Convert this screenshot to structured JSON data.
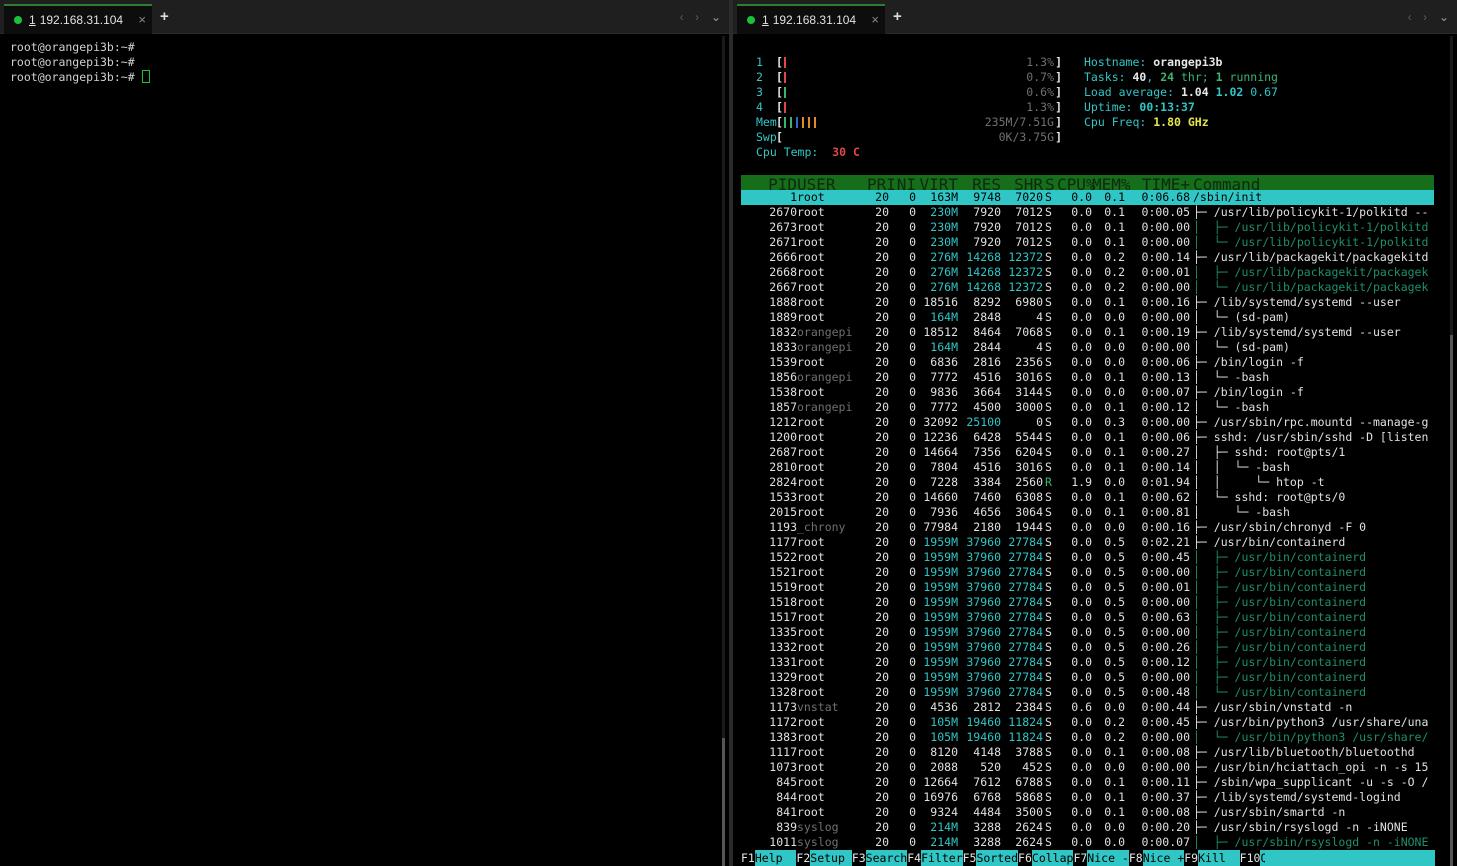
{
  "left_pane": {
    "tab": {
      "number": "1",
      "title": "192.168.31.104",
      "close": "×"
    },
    "new_tab": "+",
    "nav_prev": "‹",
    "nav_next": "›",
    "dropdown": "⌄",
    "lines": [
      "root@orangepi3b:~#",
      "root@orangepi3b:~#",
      "root@orangepi3b:~# "
    ]
  },
  "right_pane": {
    "tab": {
      "number": "1",
      "title": "192.168.31.104",
      "close": "×"
    },
    "new_tab": "+",
    "nav_prev": "‹",
    "nav_next": "›",
    "dropdown": "⌄"
  },
  "htop": {
    "meters": [
      {
        "label": "1",
        "value": "1.3%",
        "fill": [
          {
            "color": "#e04848"
          }
        ]
      },
      {
        "label": "2",
        "value": "0.7%",
        "fill": [
          {
            "color": "#e04848"
          }
        ]
      },
      {
        "label": "3",
        "value": "0.6%",
        "fill": [
          {
            "color": "#3cb371"
          }
        ]
      },
      {
        "label": "4",
        "value": "1.3%",
        "fill": [
          {
            "color": "#e04848"
          }
        ]
      },
      {
        "label": "Mem",
        "value": "235M/7.51G",
        "fill": [
          {
            "color": "#3cb371"
          },
          {
            "color": "#3cb371"
          },
          {
            "color": "#3566c9"
          },
          {
            "color": "#e08a2c"
          },
          {
            "color": "#e08a2c"
          },
          {
            "color": "#e08a2c"
          }
        ]
      },
      {
        "label": "Swp",
        "value": "0K/3.75G",
        "fill": []
      }
    ],
    "cpu_temp_label": "Cpu Temp:",
    "cpu_temp_value": "30 C",
    "info": {
      "hostname_label": "Hostname:",
      "hostname": "orangepi3b",
      "tasks_label": "Tasks:",
      "tasks": "40",
      "threads": "24",
      "thr_label": "thr;",
      "running": "1",
      "running_label": "running",
      "load_label": "Load average:",
      "load1": "1.04",
      "load5": "1.02",
      "load15": "0.67",
      "uptime_label": "Uptime:",
      "uptime": "00:13:37",
      "freq_label": "Cpu Freq:",
      "freq": "1.80 GHz"
    },
    "columns": [
      "PID",
      "USER",
      "PRI",
      "NI",
      "VIRT",
      "RES",
      "SHR",
      "S",
      "CPU%",
      "MEM%",
      "TIME+",
      "Command"
    ],
    "processes": [
      {
        "pid": "1",
        "user": "root",
        "pri": "20",
        "ni": "0",
        "virt": "163M",
        "res": "9748",
        "shr": "7020",
        "s": "S",
        "cpu": "0.0",
        "mem": "0.1",
        "time": "0:06.68",
        "cmd": "/sbin/init",
        "sub": false
      },
      {
        "pid": "2670",
        "user": "root",
        "pri": "20",
        "ni": "0",
        "virt": "230M",
        "res": "7920",
        "shr": "7012",
        "s": "S",
        "cpu": "0.0",
        "mem": "0.1",
        "time": "0:00.05",
        "cmd": "├─ /usr/lib/policykit-1/polkitd --",
        "sub": false
      },
      {
        "pid": "2673",
        "user": "root",
        "pri": "20",
        "ni": "0",
        "virt": "230M",
        "res": "7920",
        "shr": "7012",
        "s": "S",
        "cpu": "0.0",
        "mem": "0.1",
        "time": "0:00.00",
        "cmd": "│  ├─ /usr/lib/policykit-1/polkitd",
        "sub": true
      },
      {
        "pid": "2671",
        "user": "root",
        "pri": "20",
        "ni": "0",
        "virt": "230M",
        "res": "7920",
        "shr": "7012",
        "s": "S",
        "cpu": "0.0",
        "mem": "0.1",
        "time": "0:00.00",
        "cmd": "│  └─ /usr/lib/policykit-1/polkitd",
        "sub": true
      },
      {
        "pid": "2666",
        "user": "root",
        "pri": "20",
        "ni": "0",
        "virt": "276M",
        "res": "14268",
        "shr": "12372",
        "s": "S",
        "cpu": "0.0",
        "mem": "0.2",
        "time": "0:00.14",
        "cmd": "├─ /usr/lib/packagekit/packagekitd",
        "sub": false
      },
      {
        "pid": "2668",
        "user": "root",
        "pri": "20",
        "ni": "0",
        "virt": "276M",
        "res": "14268",
        "shr": "12372",
        "s": "S",
        "cpu": "0.0",
        "mem": "0.2",
        "time": "0:00.01",
        "cmd": "│  ├─ /usr/lib/packagekit/packagek",
        "sub": true
      },
      {
        "pid": "2667",
        "user": "root",
        "pri": "20",
        "ni": "0",
        "virt": "276M",
        "res": "14268",
        "shr": "12372",
        "s": "S",
        "cpu": "0.0",
        "mem": "0.2",
        "time": "0:00.00",
        "cmd": "│  └─ /usr/lib/packagekit/packagek",
        "sub": true
      },
      {
        "pid": "1888",
        "user": "root",
        "pri": "20",
        "ni": "0",
        "virt": "18516",
        "res": "8292",
        "shr": "6980",
        "s": "S",
        "cpu": "0.0",
        "mem": "0.1",
        "time": "0:00.16",
        "cmd": "├─ /lib/systemd/systemd --user",
        "sub": false
      },
      {
        "pid": "1889",
        "user": "root",
        "pri": "20",
        "ni": "0",
        "virt": "164M",
        "res": "2848",
        "shr": "4",
        "s": "S",
        "cpu": "0.0",
        "mem": "0.0",
        "time": "0:00.00",
        "cmd": "│  └─ (sd-pam)",
        "sub": false
      },
      {
        "pid": "1832",
        "user": "orangepi",
        "pri": "20",
        "ni": "0",
        "virt": "18512",
        "res": "8464",
        "shr": "7068",
        "s": "S",
        "cpu": "0.0",
        "mem": "0.1",
        "time": "0:00.19",
        "cmd": "├─ /lib/systemd/systemd --user",
        "sub": false
      },
      {
        "pid": "1833",
        "user": "orangepi",
        "pri": "20",
        "ni": "0",
        "virt": "164M",
        "res": "2844",
        "shr": "4",
        "s": "S",
        "cpu": "0.0",
        "mem": "0.0",
        "time": "0:00.00",
        "cmd": "│  └─ (sd-pam)",
        "sub": false
      },
      {
        "pid": "1539",
        "user": "root",
        "pri": "20",
        "ni": "0",
        "virt": "6836",
        "res": "2816",
        "shr": "2356",
        "s": "S",
        "cpu": "0.0",
        "mem": "0.0",
        "time": "0:00.06",
        "cmd": "├─ /bin/login -f",
        "sub": false
      },
      {
        "pid": "1856",
        "user": "orangepi",
        "pri": "20",
        "ni": "0",
        "virt": "7772",
        "res": "4516",
        "shr": "3016",
        "s": "S",
        "cpu": "0.0",
        "mem": "0.1",
        "time": "0:00.13",
        "cmd": "│  └─ -bash",
        "sub": false
      },
      {
        "pid": "1538",
        "user": "root",
        "pri": "20",
        "ni": "0",
        "virt": "9836",
        "res": "3664",
        "shr": "3144",
        "s": "S",
        "cpu": "0.0",
        "mem": "0.0",
        "time": "0:00.07",
        "cmd": "├─ /bin/login -f",
        "sub": false
      },
      {
        "pid": "1857",
        "user": "orangepi",
        "pri": "20",
        "ni": "0",
        "virt": "7772",
        "res": "4500",
        "shr": "3000",
        "s": "S",
        "cpu": "0.0",
        "mem": "0.1",
        "time": "0:00.12",
        "cmd": "│  └─ -bash",
        "sub": false
      },
      {
        "pid": "1212",
        "user": "root",
        "pri": "20",
        "ni": "0",
        "virt": "32092",
        "res": "25100",
        "shr": "0",
        "s": "S",
        "cpu": "0.0",
        "mem": "0.3",
        "time": "0:00.00",
        "cmd": "├─ /usr/sbin/rpc.mountd --manage-g",
        "sub": false
      },
      {
        "pid": "1200",
        "user": "root",
        "pri": "20",
        "ni": "0",
        "virt": "12236",
        "res": "6428",
        "shr": "5544",
        "s": "S",
        "cpu": "0.0",
        "mem": "0.1",
        "time": "0:00.06",
        "cmd": "├─ sshd: /usr/sbin/sshd -D [listen",
        "sub": false
      },
      {
        "pid": "2687",
        "user": "root",
        "pri": "20",
        "ni": "0",
        "virt": "14664",
        "res": "7356",
        "shr": "6204",
        "s": "S",
        "cpu": "0.0",
        "mem": "0.1",
        "time": "0:00.27",
        "cmd": "│  ├─ sshd: root@pts/1",
        "sub": false
      },
      {
        "pid": "2810",
        "user": "root",
        "pri": "20",
        "ni": "0",
        "virt": "7804",
        "res": "4516",
        "shr": "3016",
        "s": "S",
        "cpu": "0.0",
        "mem": "0.1",
        "time": "0:00.14",
        "cmd": "│  │  └─ -bash",
        "sub": false
      },
      {
        "pid": "2824",
        "user": "root",
        "pri": "20",
        "ni": "0",
        "virt": "7228",
        "res": "3384",
        "shr": "2560",
        "s": "R",
        "cpu": "1.9",
        "mem": "0.0",
        "time": "0:01.94",
        "cmd": "│  │     └─ htop -t",
        "sub": false
      },
      {
        "pid": "1533",
        "user": "root",
        "pri": "20",
        "ni": "0",
        "virt": "14660",
        "res": "7460",
        "shr": "6308",
        "s": "S",
        "cpu": "0.0",
        "mem": "0.1",
        "time": "0:00.62",
        "cmd": "│  └─ sshd: root@pts/0",
        "sub": false
      },
      {
        "pid": "2015",
        "user": "root",
        "pri": "20",
        "ni": "0",
        "virt": "7936",
        "res": "4656",
        "shr": "3064",
        "s": "S",
        "cpu": "0.0",
        "mem": "0.1",
        "time": "0:00.81",
        "cmd": "│     └─ -bash",
        "sub": false
      },
      {
        "pid": "1193",
        "user": "_chrony",
        "pri": "20",
        "ni": "0",
        "virt": "77984",
        "res": "2180",
        "shr": "1944",
        "s": "S",
        "cpu": "0.0",
        "mem": "0.0",
        "time": "0:00.16",
        "cmd": "├─ /usr/sbin/chronyd -F 0",
        "sub": false
      },
      {
        "pid": "1177",
        "user": "root",
        "pri": "20",
        "ni": "0",
        "virt": "1959M",
        "res": "37960",
        "shr": "27784",
        "s": "S",
        "cpu": "0.0",
        "mem": "0.5",
        "time": "0:02.21",
        "cmd": "├─ /usr/bin/containerd",
        "sub": false
      },
      {
        "pid": "1522",
        "user": "root",
        "pri": "20",
        "ni": "0",
        "virt": "1959M",
        "res": "37960",
        "shr": "27784",
        "s": "S",
        "cpu": "0.0",
        "mem": "0.5",
        "time": "0:00.45",
        "cmd": "│  ├─ /usr/bin/containerd",
        "sub": true
      },
      {
        "pid": "1521",
        "user": "root",
        "pri": "20",
        "ni": "0",
        "virt": "1959M",
        "res": "37960",
        "shr": "27784",
        "s": "S",
        "cpu": "0.0",
        "mem": "0.5",
        "time": "0:00.00",
        "cmd": "│  ├─ /usr/bin/containerd",
        "sub": true
      },
      {
        "pid": "1519",
        "user": "root",
        "pri": "20",
        "ni": "0",
        "virt": "1959M",
        "res": "37960",
        "shr": "27784",
        "s": "S",
        "cpu": "0.0",
        "mem": "0.5",
        "time": "0:00.01",
        "cmd": "│  ├─ /usr/bin/containerd",
        "sub": true
      },
      {
        "pid": "1518",
        "user": "root",
        "pri": "20",
        "ni": "0",
        "virt": "1959M",
        "res": "37960",
        "shr": "27784",
        "s": "S",
        "cpu": "0.0",
        "mem": "0.5",
        "time": "0:00.00",
        "cmd": "│  ├─ /usr/bin/containerd",
        "sub": true
      },
      {
        "pid": "1517",
        "user": "root",
        "pri": "20",
        "ni": "0",
        "virt": "1959M",
        "res": "37960",
        "shr": "27784",
        "s": "S",
        "cpu": "0.0",
        "mem": "0.5",
        "time": "0:00.63",
        "cmd": "│  ├─ /usr/bin/containerd",
        "sub": true
      },
      {
        "pid": "1335",
        "user": "root",
        "pri": "20",
        "ni": "0",
        "virt": "1959M",
        "res": "37960",
        "shr": "27784",
        "s": "S",
        "cpu": "0.0",
        "mem": "0.5",
        "time": "0:00.00",
        "cmd": "│  ├─ /usr/bin/containerd",
        "sub": true
      },
      {
        "pid": "1332",
        "user": "root",
        "pri": "20",
        "ni": "0",
        "virt": "1959M",
        "res": "37960",
        "shr": "27784",
        "s": "S",
        "cpu": "0.0",
        "mem": "0.5",
        "time": "0:00.26",
        "cmd": "│  ├─ /usr/bin/containerd",
        "sub": true
      },
      {
        "pid": "1331",
        "user": "root",
        "pri": "20",
        "ni": "0",
        "virt": "1959M",
        "res": "37960",
        "shr": "27784",
        "s": "S",
        "cpu": "0.0",
        "mem": "0.5",
        "time": "0:00.12",
        "cmd": "│  ├─ /usr/bin/containerd",
        "sub": true
      },
      {
        "pid": "1329",
        "user": "root",
        "pri": "20",
        "ni": "0",
        "virt": "1959M",
        "res": "37960",
        "shr": "27784",
        "s": "S",
        "cpu": "0.0",
        "mem": "0.5",
        "time": "0:00.00",
        "cmd": "│  ├─ /usr/bin/containerd",
        "sub": true
      },
      {
        "pid": "1328",
        "user": "root",
        "pri": "20",
        "ni": "0",
        "virt": "1959M",
        "res": "37960",
        "shr": "27784",
        "s": "S",
        "cpu": "0.0",
        "mem": "0.5",
        "time": "0:00.48",
        "cmd": "│  └─ /usr/bin/containerd",
        "sub": true
      },
      {
        "pid": "1173",
        "user": "vnstat",
        "pri": "20",
        "ni": "0",
        "virt": "4536",
        "res": "2812",
        "shr": "2384",
        "s": "S",
        "cpu": "0.6",
        "mem": "0.0",
        "time": "0:00.44",
        "cmd": "├─ /usr/sbin/vnstatd -n",
        "sub": false
      },
      {
        "pid": "1172",
        "user": "root",
        "pri": "20",
        "ni": "0",
        "virt": "105M",
        "res": "19460",
        "shr": "11824",
        "s": "S",
        "cpu": "0.0",
        "mem": "0.2",
        "time": "0:00.45",
        "cmd": "├─ /usr/bin/python3 /usr/share/una",
        "sub": false
      },
      {
        "pid": "1383",
        "user": "root",
        "pri": "20",
        "ni": "0",
        "virt": "105M",
        "res": "19460",
        "shr": "11824",
        "s": "S",
        "cpu": "0.0",
        "mem": "0.2",
        "time": "0:00.00",
        "cmd": "│  └─ /usr/bin/python3 /usr/share/",
        "sub": true
      },
      {
        "pid": "1117",
        "user": "root",
        "pri": "20",
        "ni": "0",
        "virt": "8120",
        "res": "4148",
        "shr": "3788",
        "s": "S",
        "cpu": "0.0",
        "mem": "0.1",
        "time": "0:00.08",
        "cmd": "├─ /usr/lib/bluetooth/bluetoothd",
        "sub": false
      },
      {
        "pid": "1073",
        "user": "root",
        "pri": "20",
        "ni": "0",
        "virt": "2088",
        "res": "520",
        "shr": "452",
        "s": "S",
        "cpu": "0.0",
        "mem": "0.0",
        "time": "0:00.00",
        "cmd": "├─ /usr/bin/hciattach_opi -n -s 15",
        "sub": false
      },
      {
        "pid": "845",
        "user": "root",
        "pri": "20",
        "ni": "0",
        "virt": "12664",
        "res": "7612",
        "shr": "6788",
        "s": "S",
        "cpu": "0.0",
        "mem": "0.1",
        "time": "0:00.11",
        "cmd": "├─ /sbin/wpa_supplicant -u -s -O /",
        "sub": false
      },
      {
        "pid": "844",
        "user": "root",
        "pri": "20",
        "ni": "0",
        "virt": "16976",
        "res": "6768",
        "shr": "5868",
        "s": "S",
        "cpu": "0.0",
        "mem": "0.1",
        "time": "0:00.37",
        "cmd": "├─ /lib/systemd/systemd-logind",
        "sub": false
      },
      {
        "pid": "841",
        "user": "root",
        "pri": "20",
        "ni": "0",
        "virt": "9324",
        "res": "4484",
        "shr": "3500",
        "s": "S",
        "cpu": "0.0",
        "mem": "0.1",
        "time": "0:00.08",
        "cmd": "├─ /usr/sbin/smartd -n",
        "sub": false
      },
      {
        "pid": "839",
        "user": "syslog",
        "pri": "20",
        "ni": "0",
        "virt": "214M",
        "res": "3288",
        "shr": "2624",
        "s": "S",
        "cpu": "0.0",
        "mem": "0.0",
        "time": "0:00.20",
        "cmd": "├─ /usr/sbin/rsyslogd -n -iNONE",
        "sub": false
      },
      {
        "pid": "1011",
        "user": "syslog",
        "pri": "20",
        "ni": "0",
        "virt": "214M",
        "res": "3288",
        "shr": "2624",
        "s": "S",
        "cpu": "0.0",
        "mem": "0.0",
        "time": "0:00.07",
        "cmd": "│  ├─ /usr/sbin/rsyslogd -n -iNONE",
        "sub": true
      }
    ],
    "function_keys": [
      {
        "key": "F1",
        "label": "Help  "
      },
      {
        "key": "F2",
        "label": "Setup "
      },
      {
        "key": "F3",
        "label": "Search"
      },
      {
        "key": "F4",
        "label": "Filter"
      },
      {
        "key": "F5",
        "label": "Sorted"
      },
      {
        "key": "F6",
        "label": "Collap"
      },
      {
        "key": "F7",
        "label": "Nice -"
      },
      {
        "key": "F8",
        "label": "Nice +"
      },
      {
        "key": "F9",
        "label": "Kill  "
      },
      {
        "key": "F10",
        "label": "Quit"
      }
    ]
  }
}
